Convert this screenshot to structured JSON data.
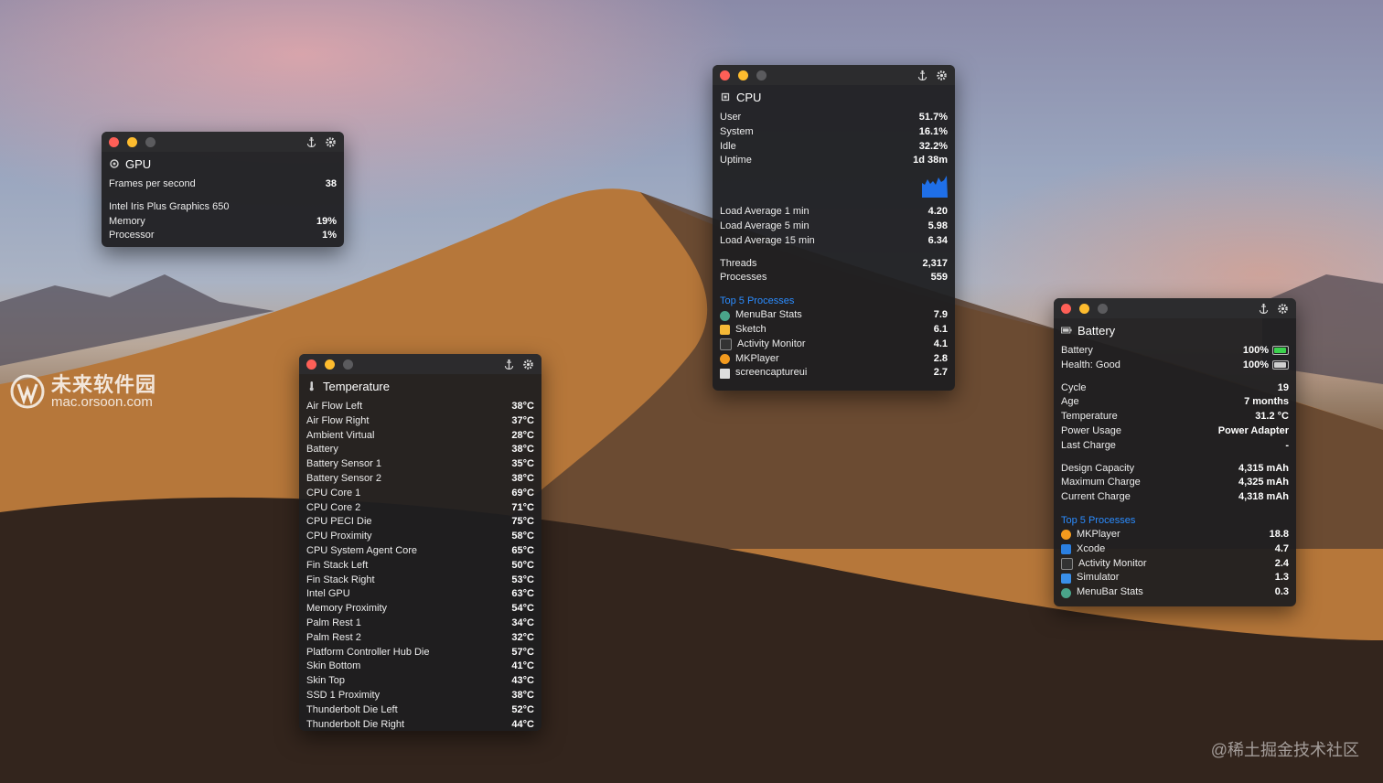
{
  "colors": {
    "accent_blue": "#2b8cff",
    "close": "#fe5f57",
    "minimize": "#febc2e",
    "zoom": "#5b5b5e",
    "battery_green": "#3cd14e"
  },
  "gpu": {
    "title": "GPU",
    "fps_label": "Frames per second",
    "fps_value": "38",
    "device": "Intel Iris Plus Graphics 650",
    "rows": [
      {
        "label": "Memory",
        "value": "19%"
      },
      {
        "label": "Processor",
        "value": "1%"
      }
    ]
  },
  "cpu": {
    "title": "CPU",
    "stats": [
      {
        "label": "User",
        "value": "51.7%"
      },
      {
        "label": "System",
        "value": "16.1%"
      },
      {
        "label": "Idle",
        "value": "32.2%"
      },
      {
        "label": "Uptime",
        "value": "1d 38m"
      }
    ],
    "load": [
      {
        "label": "Load Average 1 min",
        "value": "4.20"
      },
      {
        "label": "Load Average 5 min",
        "value": "5.98"
      },
      {
        "label": "Load Average 15 min",
        "value": "6.34"
      }
    ],
    "counts": [
      {
        "label": "Threads",
        "value": "2,317"
      },
      {
        "label": "Processes",
        "value": "559"
      }
    ],
    "top_label": "Top 5 Processes",
    "processes": [
      {
        "name": "MenuBar Stats",
        "value": "7.9",
        "icon": "globe-icon"
      },
      {
        "name": "Sketch",
        "value": "6.1",
        "icon": "sketch-icon"
      },
      {
        "name": "Activity Monitor",
        "value": "4.1",
        "icon": "activity-monitor-icon"
      },
      {
        "name": "MKPlayer",
        "value": "2.8",
        "icon": "play-icon"
      },
      {
        "name": "screencaptureui",
        "value": "2.7",
        "icon": "document-icon"
      }
    ]
  },
  "temperature": {
    "title": "Temperature",
    "sensors": [
      {
        "label": "Air Flow Left",
        "value": "38°C"
      },
      {
        "label": "Air Flow Right",
        "value": "37°C"
      },
      {
        "label": "Ambient Virtual",
        "value": "28°C"
      },
      {
        "label": "Battery",
        "value": "38°C"
      },
      {
        "label": "Battery Sensor 1",
        "value": "35°C"
      },
      {
        "label": "Battery Sensor 2",
        "value": "38°C"
      },
      {
        "label": "CPU Core 1",
        "value": "69°C"
      },
      {
        "label": "CPU Core 2",
        "value": "71°C"
      },
      {
        "label": "CPU PECI Die",
        "value": "75°C"
      },
      {
        "label": "CPU Proximity",
        "value": "58°C"
      },
      {
        "label": "CPU System Agent Core",
        "value": "65°C"
      },
      {
        "label": "Fin Stack Left",
        "value": "50°C"
      },
      {
        "label": "Fin Stack Right",
        "value": "53°C"
      },
      {
        "label": "Intel GPU",
        "value": "63°C"
      },
      {
        "label": "Memory Proximity",
        "value": "54°C"
      },
      {
        "label": "Palm Rest 1",
        "value": "34°C"
      },
      {
        "label": "Palm Rest 2",
        "value": "32°C"
      },
      {
        "label": "Platform Controller Hub Die",
        "value": "57°C"
      },
      {
        "label": "Skin Bottom",
        "value": "41°C"
      },
      {
        "label": "Skin Top",
        "value": "43°C"
      },
      {
        "label": "SSD 1 Proximity",
        "value": "38°C"
      },
      {
        "label": "Thunderbolt Die Left",
        "value": "52°C"
      },
      {
        "label": "Thunderbolt Die Right",
        "value": "44°C"
      }
    ]
  },
  "battery": {
    "title": "Battery",
    "level": [
      {
        "label": "Battery",
        "value": "100%",
        "fraction": 1.0
      },
      {
        "label": "Health: Good",
        "value": "100%",
        "fraction": 1.0
      }
    ],
    "info": [
      {
        "label": "Cycle",
        "value": "19"
      },
      {
        "label": "Age",
        "value": "7 months"
      },
      {
        "label": "Temperature",
        "value": "31.2 °C"
      },
      {
        "label": "Power Usage",
        "value": "Power Adapter"
      },
      {
        "label": "Last Charge",
        "value": "-"
      }
    ],
    "capacity": [
      {
        "label": "Design Capacity",
        "value": "4,315 mAh"
      },
      {
        "label": "Maximum Charge",
        "value": "4,325 mAh"
      },
      {
        "label": "Current Charge",
        "value": "4,318 mAh"
      }
    ],
    "top_label": "Top 5 Processes",
    "processes": [
      {
        "name": "MKPlayer",
        "value": "18.8",
        "icon": "play-icon"
      },
      {
        "name": "Xcode",
        "value": "4.7",
        "icon": "xcode-icon"
      },
      {
        "name": "Activity Monitor",
        "value": "2.4",
        "icon": "activity-monitor-icon"
      },
      {
        "name": "Simulator",
        "value": "1.3",
        "icon": "simulator-icon"
      },
      {
        "name": "MenuBar Stats",
        "value": "0.3",
        "icon": "globe-icon"
      }
    ]
  },
  "watermarks": {
    "left_title": "未来软件园",
    "left_sub": "mac.orsoon.com",
    "right": "@稀土掘金技术社区"
  }
}
